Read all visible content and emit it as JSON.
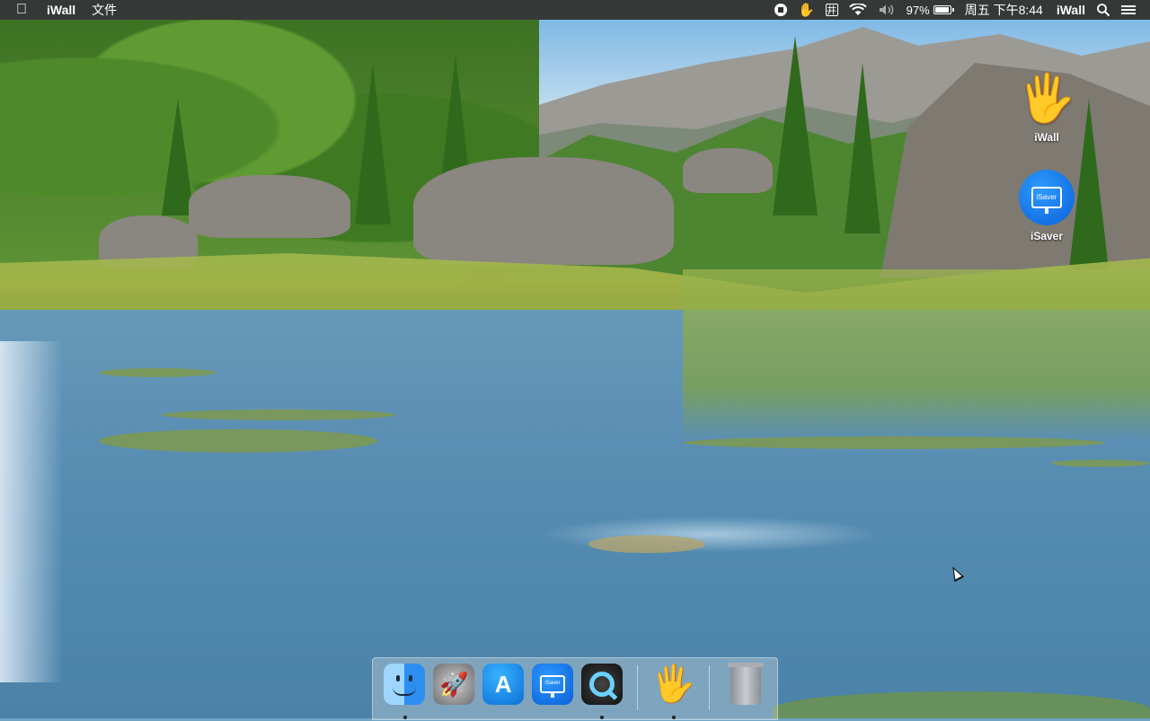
{
  "menubar": {
    "apple_icon": "apple-icon",
    "app_name": "iWall",
    "menus": [
      "文件"
    ],
    "status": {
      "battery_percent": "97%",
      "battery_level": 0.97,
      "datetime": "周五 下午8:44",
      "app_name": "iWall",
      "grid_glyph": "井"
    }
  },
  "desktop_icons": [
    {
      "label": "iWall",
      "icon": "hand-icon"
    },
    {
      "label": "iSaver",
      "icon": "monitor-icon",
      "screen_text": "iSaver"
    }
  ],
  "dock": {
    "items": [
      {
        "name": "Finder",
        "icon": "finder-icon",
        "running": true
      },
      {
        "name": "Launchpad",
        "icon": "rocket-icon",
        "running": false
      },
      {
        "name": "App Store",
        "icon": "app-store-icon",
        "running": false
      },
      {
        "name": "iSaver",
        "icon": "monitor-icon",
        "screen_text": "iSaver",
        "running": false
      },
      {
        "name": "QuickTime Player",
        "icon": "quicktime-icon",
        "running": true
      },
      {
        "name": "iWall",
        "icon": "hand-icon",
        "running": true
      },
      {
        "name": "Trash",
        "icon": "trash-icon",
        "running": false
      }
    ]
  },
  "colors": {
    "menubar_bg": "#2d2d28",
    "isaver_blue": "#0a5fd8"
  }
}
